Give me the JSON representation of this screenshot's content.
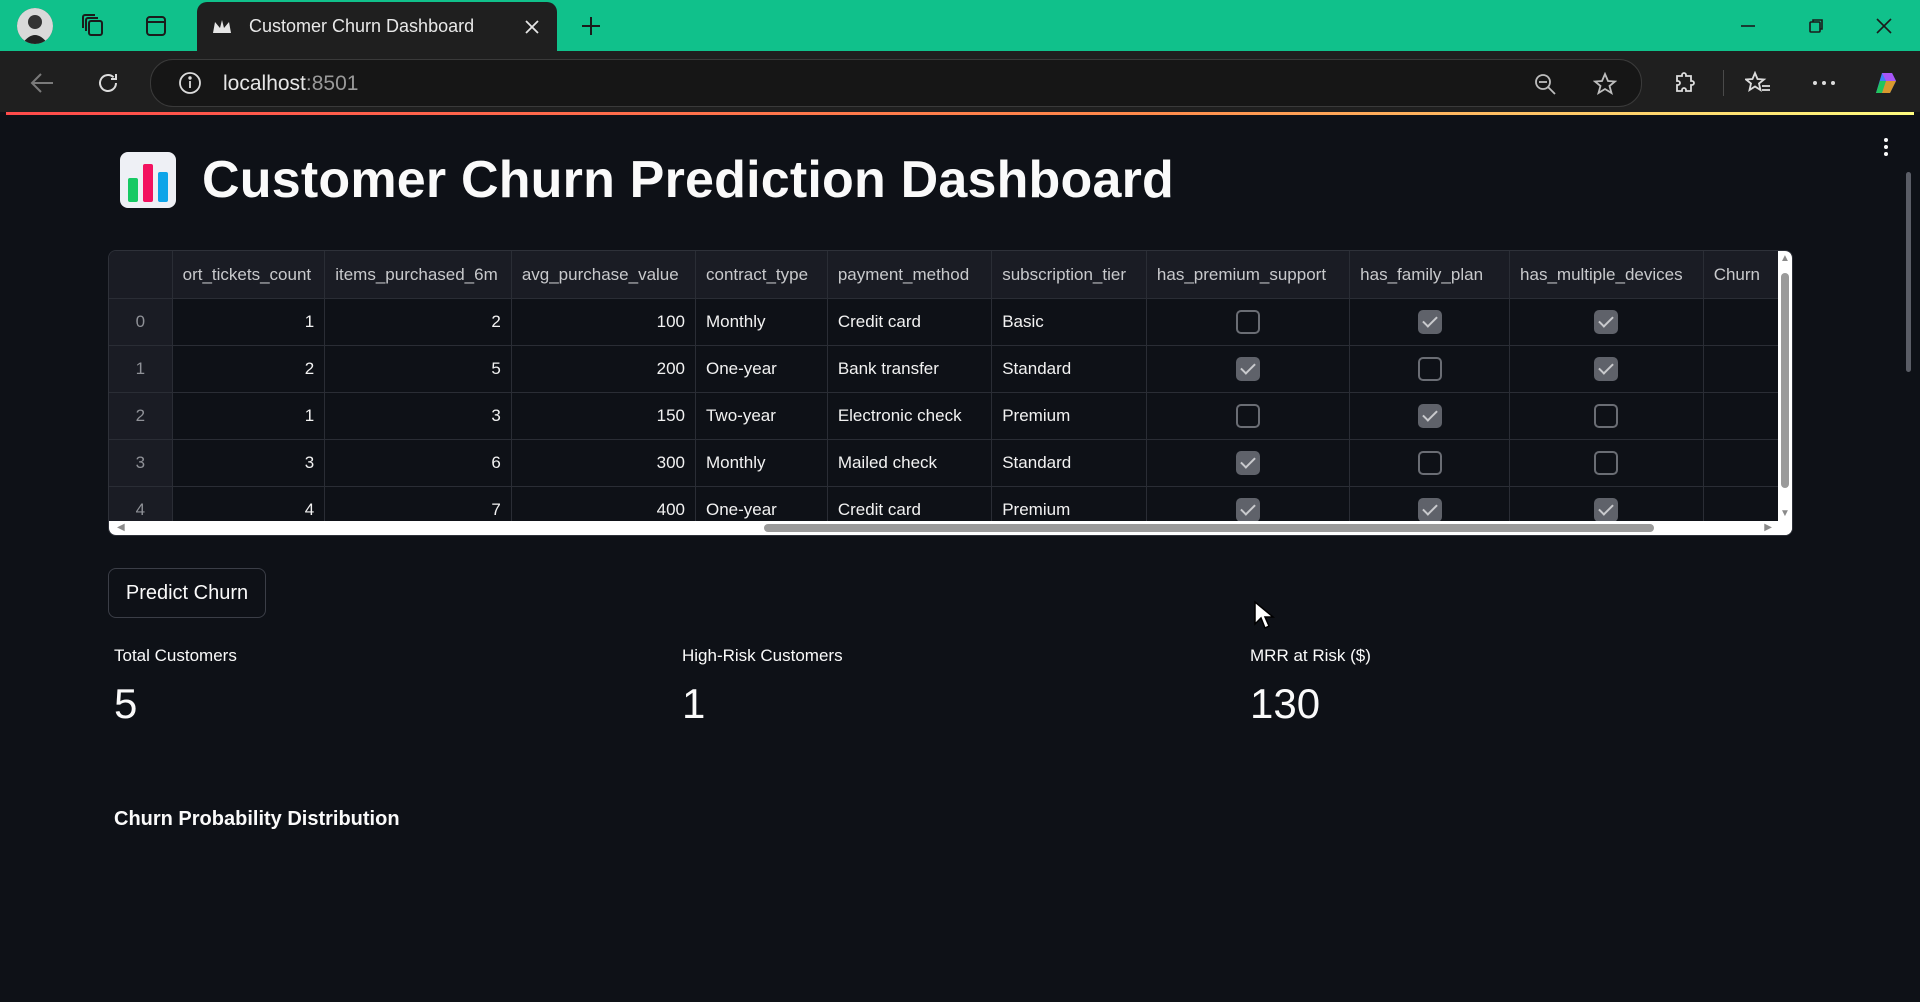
{
  "browser": {
    "tab_title": "Customer Churn Dashboard",
    "url_host": "localhost",
    "url_port": ":8501"
  },
  "page": {
    "title": "Customer Churn Prediction Dashboard",
    "predict_button": "Predict Churn",
    "subheader": "Churn Probability Distribution"
  },
  "table": {
    "columns": [
      "",
      "ort_tickets_count",
      "items_purchased_6m",
      "avg_purchase_value",
      "contract_type",
      "payment_method",
      "subscription_tier",
      "has_premium_support",
      "has_family_plan",
      "has_multiple_devices",
      "Churn"
    ],
    "rows": [
      {
        "index": "0",
        "support_tickets_count": "1",
        "items_purchased_6m": "2",
        "avg_purchase_value": "100",
        "contract_type": "Monthly",
        "payment_method": "Credit card",
        "subscription_tier": "Basic",
        "has_premium_support": false,
        "has_family_plan": true,
        "has_multiple_devices": true,
        "churn": ""
      },
      {
        "index": "1",
        "support_tickets_count": "2",
        "items_purchased_6m": "5",
        "avg_purchase_value": "200",
        "contract_type": "One-year",
        "payment_method": "Bank transfer",
        "subscription_tier": "Standard",
        "has_premium_support": true,
        "has_family_plan": false,
        "has_multiple_devices": true,
        "churn": ""
      },
      {
        "index": "2",
        "support_tickets_count": "1",
        "items_purchased_6m": "3",
        "avg_purchase_value": "150",
        "contract_type": "Two-year",
        "payment_method": "Electronic check",
        "subscription_tier": "Premium",
        "has_premium_support": false,
        "has_family_plan": true,
        "has_multiple_devices": false,
        "churn": ""
      },
      {
        "index": "3",
        "support_tickets_count": "3",
        "items_purchased_6m": "6",
        "avg_purchase_value": "300",
        "contract_type": "Monthly",
        "payment_method": "Mailed check",
        "subscription_tier": "Standard",
        "has_premium_support": true,
        "has_family_plan": false,
        "has_multiple_devices": false,
        "churn": ""
      },
      {
        "index": "4",
        "support_tickets_count": "4",
        "items_purchased_6m": "7",
        "avg_purchase_value": "400",
        "contract_type": "One-year",
        "payment_method": "Credit card",
        "subscription_tier": "Premium",
        "has_premium_support": true,
        "has_family_plan": true,
        "has_multiple_devices": true,
        "churn": ""
      }
    ]
  },
  "metrics": [
    {
      "label": "Total Customers",
      "value": "5"
    },
    {
      "label": "High-Risk Customers",
      "value": "1"
    },
    {
      "label": "MRR at Risk ($)",
      "value": "130"
    }
  ],
  "colors": {
    "tabbar": "#10c18b",
    "background": "#0e1117",
    "accent": "#ff4b4b"
  }
}
